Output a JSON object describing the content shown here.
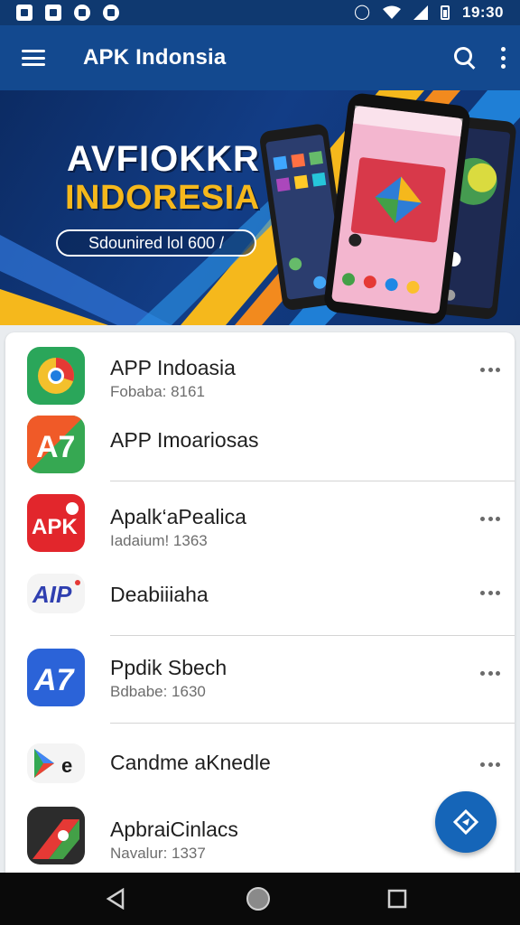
{
  "status_bar": {
    "time": "19:30",
    "left_icons": [
      "gallery-icon",
      "mail-icon",
      "shield-icon",
      "chat-icon"
    ],
    "right_icons": [
      "alarm-icon",
      "wifi-icon",
      "signal-icon",
      "battery-icon"
    ]
  },
  "app_bar": {
    "title": "APK Indonsia",
    "icons": [
      "menu-icon",
      "search-icon",
      "more-vert-icon"
    ]
  },
  "banner": {
    "title": "AVFIOKKR",
    "subtitle": "INDORESIA",
    "pill_text": "Sdounired lol 600 /"
  },
  "apps": [
    {
      "name": "APP Indoasia",
      "sub": "Fobaba: 8161",
      "has_menu": true,
      "icon": "chrome-like-icon"
    },
    {
      "name": "APP Imoariosas",
      "sub": "",
      "has_menu": false,
      "icon": "a7-orange-icon"
    },
    {
      "name": "Apalk‘aPealica",
      "sub": "Iadaium! 1363",
      "has_menu": true,
      "icon": "apk-red-icon"
    },
    {
      "name": "Deabiiiaha",
      "sub": "",
      "has_menu": true,
      "icon": "aip-logo-icon"
    },
    {
      "name": "Ppdik Sbech",
      "sub": "Bdbabe: 1630",
      "has_menu": true,
      "icon": "a7-blue-icon"
    },
    {
      "name": "Candme aKnedle",
      "sub": "",
      "has_menu": true,
      "icon": "play-store-icon"
    },
    {
      "name": "ApbraiCinlacs",
      "sub": "Navalur: 1337",
      "has_menu": false,
      "icon": "a7-dark-icon"
    }
  ],
  "colors": {
    "status_bar": "#0f3970",
    "app_bar": "#13498f",
    "accent_yellow": "#f5b81c",
    "fab": "#1565b8",
    "nav_bar": "#0a0a0a"
  },
  "nav_bar": {
    "buttons": [
      "back-icon",
      "home-icon",
      "recents-icon"
    ]
  }
}
